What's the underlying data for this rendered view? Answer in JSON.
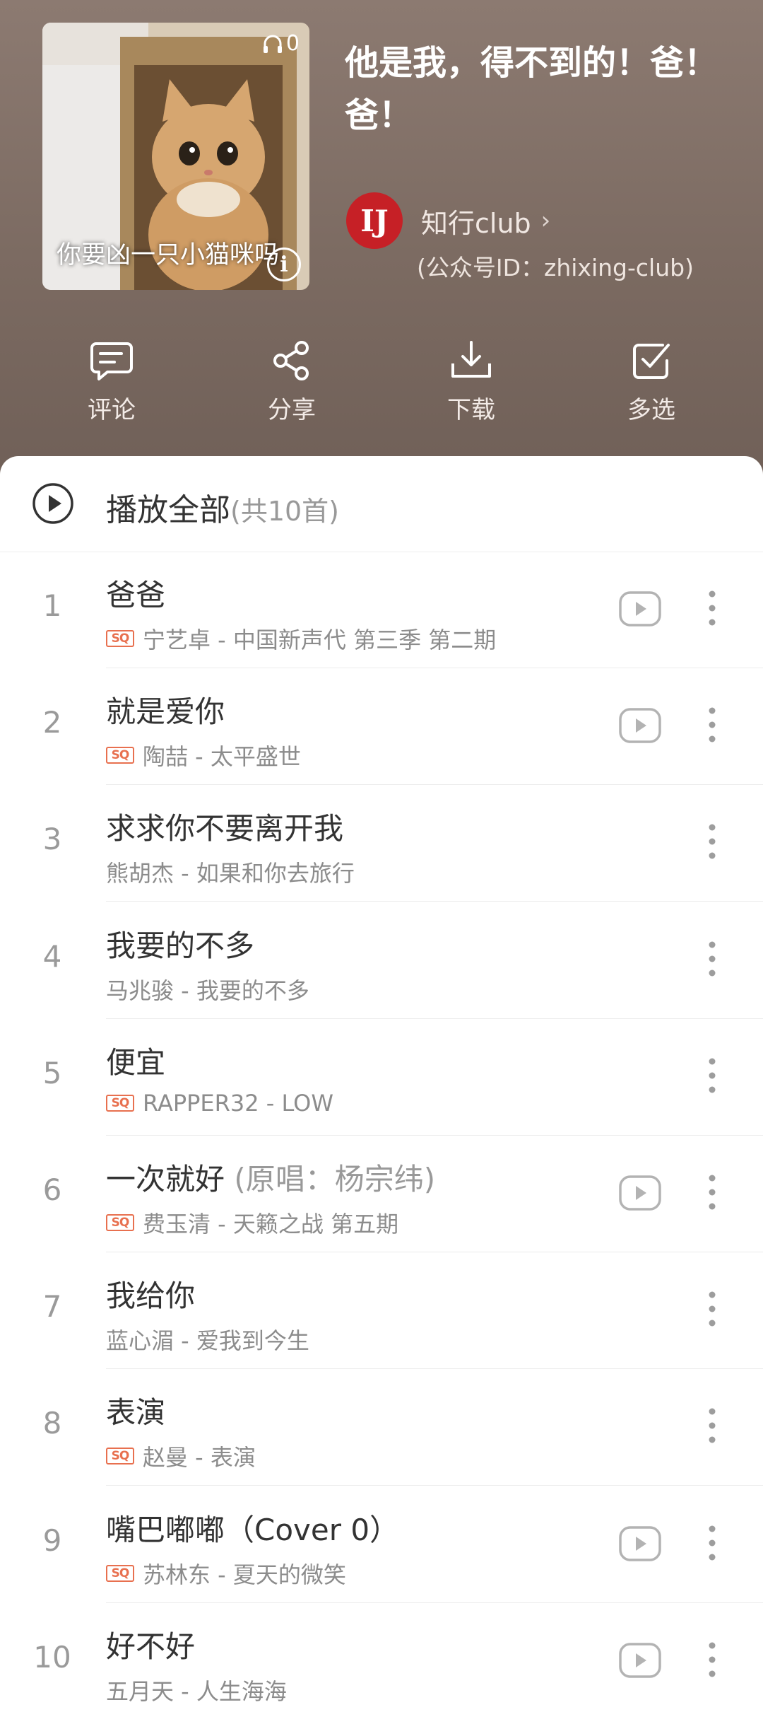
{
  "header": {
    "title": "他是我，得不到的！爸！爸！",
    "cover": {
      "listen_count": "0",
      "caption": "你要凶一只小猫咪吗",
      "info_icon": "info-icon"
    },
    "creator": {
      "avatar_text": "IJ",
      "name": "知行club",
      "id_text": "(公众号ID：zhixing-club)"
    },
    "actions": [
      {
        "label": "评论",
        "icon": "comment-icon"
      },
      {
        "label": "分享",
        "icon": "share-icon"
      },
      {
        "label": "下载",
        "icon": "download-icon"
      },
      {
        "label": "多选",
        "icon": "multiselect-icon"
      }
    ],
    "colors": {
      "header_bg": "#7f6d64",
      "avatar_bg": "#c62026",
      "sq_badge": "#e8704f"
    }
  },
  "play_all": {
    "label": "播放全部",
    "count": "(共10首)"
  },
  "badge_label": "SQ",
  "songs": [
    {
      "index": "1",
      "title": "爸爸",
      "title_extra": "",
      "subtitle": "宁艺卓 - 中国新声代  第三季  第二期",
      "sq": true,
      "mv": true
    },
    {
      "index": "2",
      "title": "就是爱你",
      "title_extra": "",
      "subtitle": "陶喆 - 太平盛世",
      "sq": true,
      "mv": true
    },
    {
      "index": "3",
      "title": "求求你不要离开我",
      "title_extra": "",
      "subtitle": "熊胡杰 - 如果和你去旅行",
      "sq": false,
      "mv": false
    },
    {
      "index": "4",
      "title": "我要的不多",
      "title_extra": "",
      "subtitle": "马兆骏 - 我要的不多",
      "sq": false,
      "mv": false
    },
    {
      "index": "5",
      "title": "便宜",
      "title_extra": "",
      "subtitle": "RAPPER32 - LOW",
      "sq": true,
      "mv": false
    },
    {
      "index": "6",
      "title": "一次就好",
      "title_extra": " (原唱：杨宗纬)",
      "subtitle": "费玉清 - 天籁之战 第五期",
      "sq": true,
      "mv": true
    },
    {
      "index": "7",
      "title": "我给你",
      "title_extra": "",
      "subtitle": "蓝心湄 - 爱我到今生",
      "sq": false,
      "mv": false
    },
    {
      "index": "8",
      "title": "表演",
      "title_extra": "",
      "subtitle": "赵曼 - 表演",
      "sq": true,
      "mv": false
    },
    {
      "index": "9",
      "title": "嘴巴嘟嘟（Cover 0）",
      "title_extra": "",
      "subtitle": "苏林东 - 夏天的微笑",
      "sq": true,
      "mv": true
    },
    {
      "index": "10",
      "title": "好不好",
      "title_extra": "",
      "subtitle": "五月天 - 人生海海",
      "sq": false,
      "mv": true
    }
  ]
}
